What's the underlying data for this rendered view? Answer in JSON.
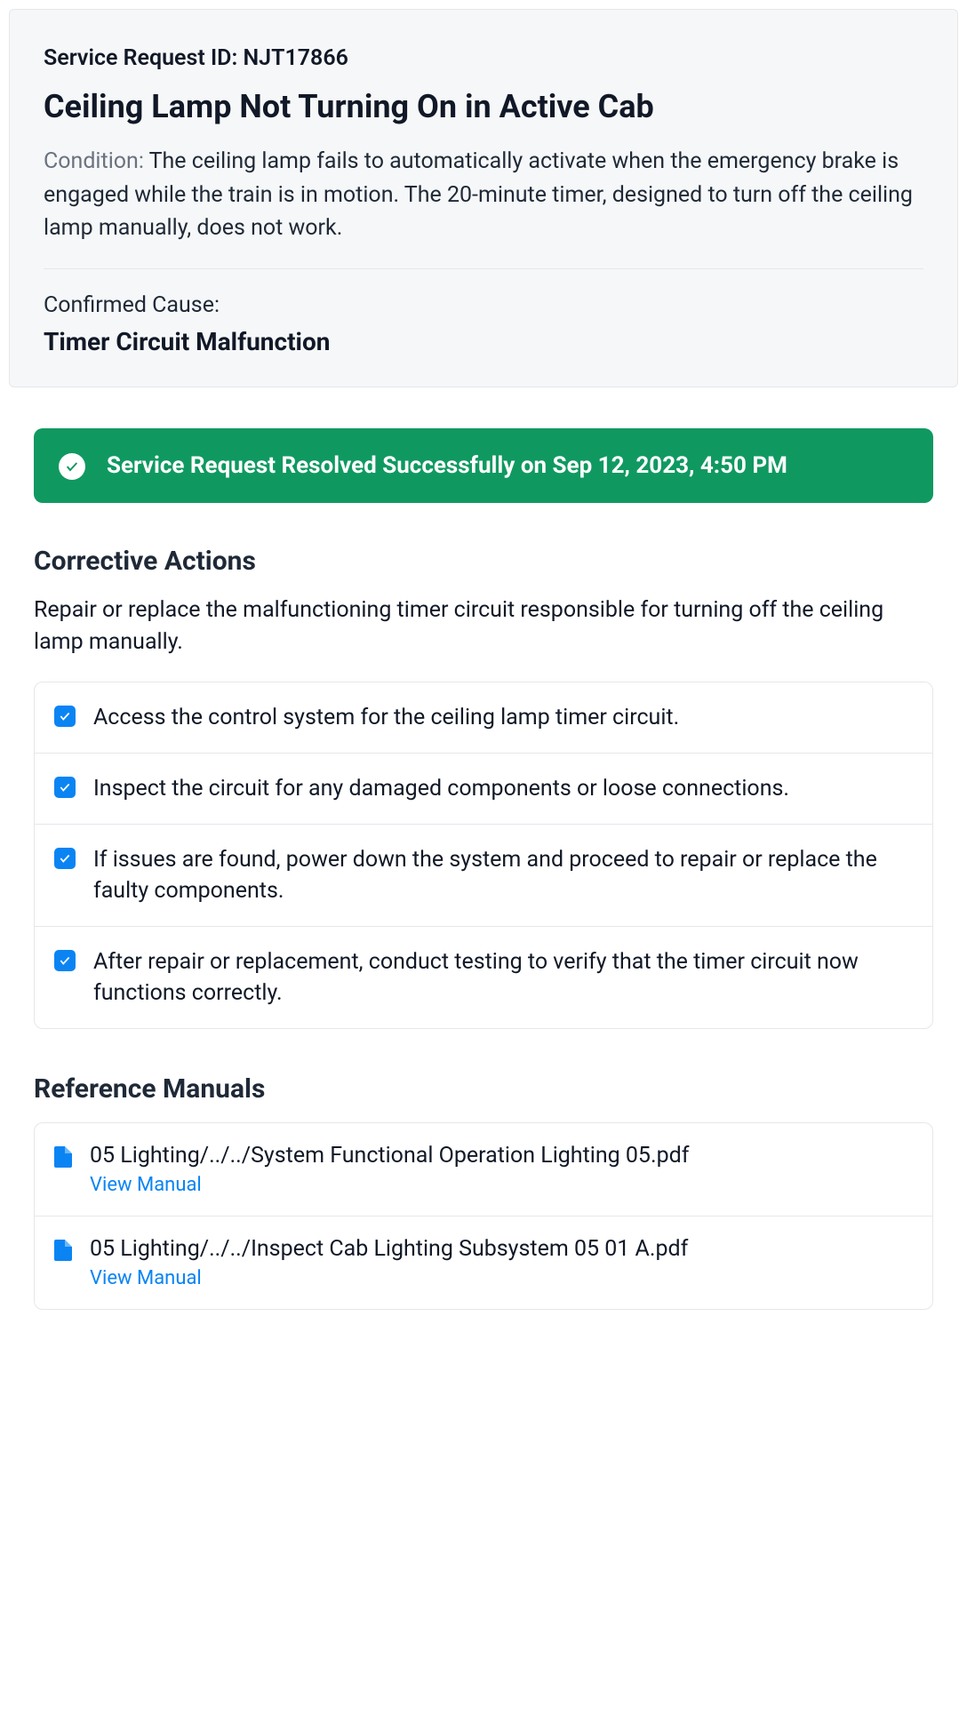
{
  "header": {
    "id_label": "Service Request ID:",
    "id_value": "NJT17866",
    "title": "Ceiling Lamp Not Turning On in Active Cab",
    "condition_label": "Condition:",
    "condition_text": "The ceiling lamp fails to automatically activate when the emergency brake is engaged while the train is in motion. The 20-minute timer, designed to turn off the ceiling lamp manually, does not work.",
    "cause_label": "Confirmed Cause:",
    "cause_value": "Timer Circuit Malfunction"
  },
  "resolved": {
    "text": "Service Request Resolved Successfully on Sep 12, 2023, 4:50 PM"
  },
  "corrective": {
    "title": "Corrective Actions",
    "desc": "Repair or replace the malfunctioning timer circuit responsible for turning off the ceiling lamp manually.",
    "items": [
      {
        "checked": true,
        "text": "Access the control system for the ceiling lamp timer circuit."
      },
      {
        "checked": true,
        "text": "Inspect the circuit for any damaged components or loose connections."
      },
      {
        "checked": true,
        "text": "If issues are found, power down the system and proceed to repair or replace the faulty components."
      },
      {
        "checked": true,
        "text": "After repair or replacement, conduct testing to verify that the timer circuit now functions correctly."
      }
    ]
  },
  "manuals": {
    "title": "Reference Manuals",
    "link_label": "View Manual",
    "items": [
      {
        "path": "05 Lighting/../../System Functional Operation Lighting 05.pdf"
      },
      {
        "path": "05 Lighting/../../Inspect Cab Lighting Subsystem 05 01 A.pdf"
      }
    ]
  }
}
